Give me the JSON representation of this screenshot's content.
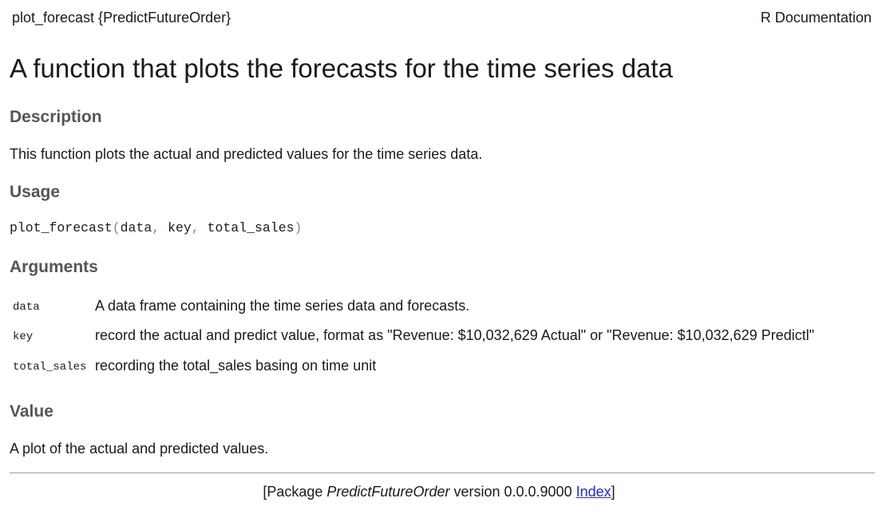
{
  "header": {
    "left": "plot_forecast {PredictFutureOrder}",
    "right": "R Documentation"
  },
  "title": "A function that plots the forecasts for the time series data",
  "sections": {
    "description": {
      "heading": "Description",
      "text": "This function plots the actual and predicted values for the time series data."
    },
    "usage": {
      "heading": "Usage",
      "fn": "plot_forecast",
      "open": "(",
      "args": [
        "data",
        "key",
        "total_sales"
      ],
      "sep": ", ",
      "close": ")"
    },
    "arguments": {
      "heading": "Arguments",
      "items": [
        {
          "name": "data",
          "desc": "A data frame containing the time series data and forecasts."
        },
        {
          "name": "key",
          "desc": "record the actual and predict value, format as \"Revenue: $10,032,629 Actual\" or \"Revenue: $10,032,629 Predictl\""
        },
        {
          "name": "total_sales",
          "desc": "recording the total_sales basing on time unit"
        }
      ]
    },
    "value": {
      "heading": "Value",
      "text": "A plot of the actual and predicted values."
    }
  },
  "footer": {
    "prefix": "[Package ",
    "package": "PredictFutureOrder",
    "version_text": " version 0.0.0.9000 ",
    "index_link": "Index",
    "suffix": "]"
  }
}
